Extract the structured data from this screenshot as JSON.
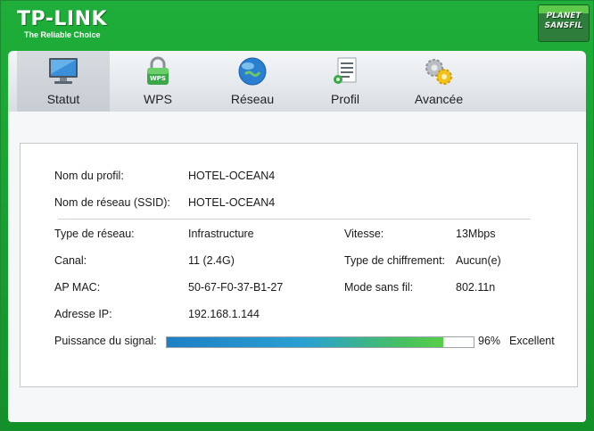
{
  "brand": {
    "name": "TP-LINK",
    "tagline": "The Reliable Choice",
    "badge_line1": "PLANET",
    "badge_line2": "SANSFIL"
  },
  "tabs": [
    {
      "label": "Statut",
      "icon": "monitor-icon",
      "active": true
    },
    {
      "label": "WPS",
      "icon": "wps-lock-icon",
      "active": false
    },
    {
      "label": "Réseau",
      "icon": "globe-icon",
      "active": false
    },
    {
      "label": "Profil",
      "icon": "profile-document-icon",
      "active": false
    },
    {
      "label": "Avancée",
      "icon": "gears-icon",
      "active": false
    }
  ],
  "status": {
    "profile_name_label": "Nom du profil:",
    "profile_name": "HOTEL-OCEAN4",
    "ssid_label": "Nom de réseau (SSID):",
    "ssid": "HOTEL-OCEAN4",
    "network_type_label": "Type de réseau:",
    "network_type": "Infrastructure",
    "speed_label": "Vitesse:",
    "speed": "13Mbps",
    "channel_label": "Canal:",
    "channel": "11 (2.4G)",
    "encryption_label": "Type de chiffrement:",
    "encryption": "Aucun(e)",
    "ap_mac_label": "AP MAC:",
    "ap_mac": "50-67-F0-37-B1-27",
    "wireless_mode_label": "Mode sans fil:",
    "wireless_mode": "802.11n",
    "ip_label": "Adresse IP:",
    "ip": "192.168.1.144",
    "signal_label": "Puissance du signal:",
    "signal_percent_text": "96%",
    "signal_quality": "Excellent",
    "signal_fraction": 0.9
  },
  "colors": {
    "header_green": "#18a233",
    "signal_blue": "#1e7fc4",
    "signal_green": "#58cf48"
  }
}
